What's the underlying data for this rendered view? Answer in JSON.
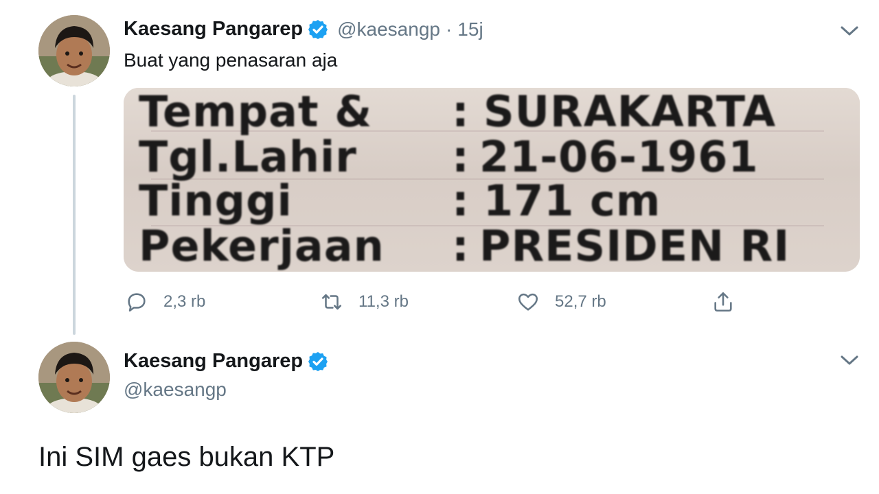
{
  "tweet1": {
    "name": "Kaesang Pangarep",
    "handle": "@kaesangp",
    "separator": "·",
    "time": "15j",
    "text": "Buat yang penasaran aja",
    "media": {
      "labels": [
        "Tempat &",
        "Tgl.Lahir",
        "Tinggi",
        "Pekerjaan"
      ],
      "colons": [
        ":",
        ":",
        ":",
        ":"
      ],
      "values": [
        "SURAKARTA",
        "21-06-1961",
        "171 cm",
        "PRESIDEN RI"
      ]
    },
    "actions": {
      "replies": "2,3 rb",
      "retweets": "11,3 rb",
      "likes": "52,7 rb"
    }
  },
  "tweet2": {
    "name": "Kaesang Pangarep",
    "handle": "@kaesangp",
    "text": "Ini SIM gaes bukan KTP"
  },
  "colors": {
    "verified": "#1da1f2",
    "secondary_text": "#657786",
    "thread_line": "#ccd6dd"
  },
  "icons": [
    "verified-badge-icon",
    "chevron-down-icon",
    "reply-icon",
    "retweet-icon",
    "like-icon",
    "share-icon"
  ]
}
